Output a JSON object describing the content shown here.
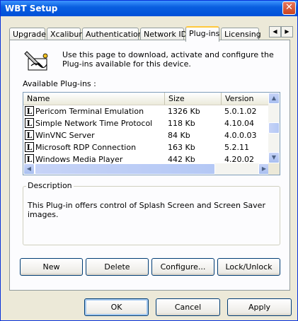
{
  "window": {
    "title": "WBT Setup",
    "close_label": "✕"
  },
  "tabs": [
    {
      "label": "Upgrade"
    },
    {
      "label": "Xcalibur"
    },
    {
      "label": "Authentication"
    },
    {
      "label": "Network ID"
    },
    {
      "label": "Plug-ins",
      "active": true
    },
    {
      "label": "Licensing"
    }
  ],
  "tab_scroll": {
    "left": "◀",
    "right": "▶"
  },
  "intro": {
    "text": "Use this page to download, activate and configure the Plug-ins available for this device."
  },
  "available_label": "Available Plug-ins :",
  "plugins": {
    "columns": [
      "Name",
      "Size",
      "Version"
    ],
    "rows": [
      {
        "icon": "L",
        "name": "Pericom Terminal Emulation",
        "size": "1326 Kb",
        "version": "5.0.1.02"
      },
      {
        "icon": "L",
        "name": "Simple Network Time Protocol",
        "size": "118 Kb",
        "version": "4.10.04"
      },
      {
        "icon": "L",
        "name": "WinVNC Server",
        "size": "84 Kb",
        "version": "4.0.0.03"
      },
      {
        "icon": "L",
        "name": "Microsoft RDP Connection",
        "size": "163 Kb",
        "version": "5.2.11"
      },
      {
        "icon": "L",
        "name": "Windows Media Player",
        "size": "442 Kb",
        "version": "4.20.02"
      }
    ]
  },
  "description": {
    "title": "Description",
    "text": "This Plug-in offers control of Splash Screen and Screen Saver images."
  },
  "actions": {
    "new": "New",
    "delete": "Delete",
    "configure": "Configure...",
    "lock_unlock": "Lock/Unlock"
  },
  "dialog_buttons": {
    "ok": "OK",
    "cancel": "Cancel",
    "apply": "Apply"
  },
  "colors": {
    "titlebar": "#0a5fe0",
    "active_tab_highlight": "#ffc83c",
    "panel": "#fcfcfe"
  }
}
